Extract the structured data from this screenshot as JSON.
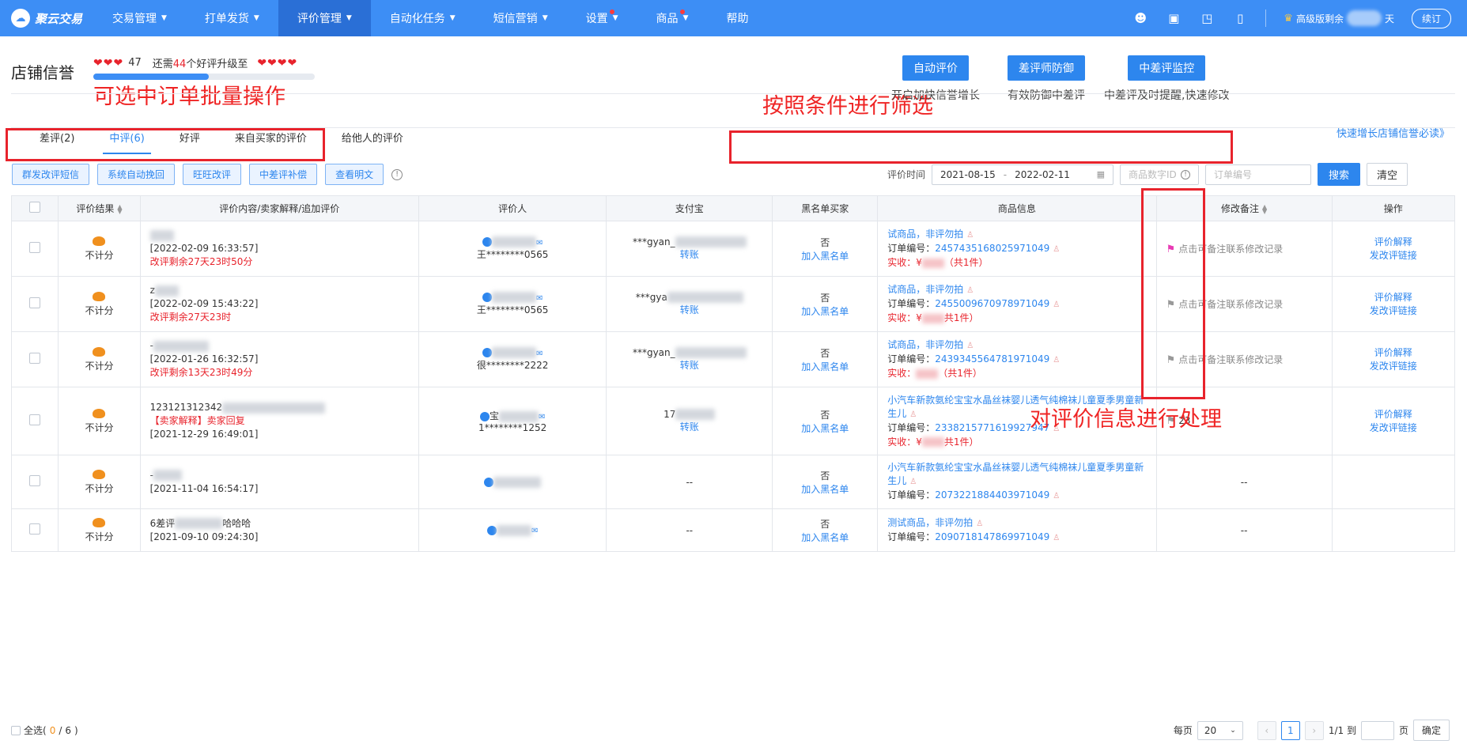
{
  "topbar": {
    "logo_text": "聚云交易",
    "nav": [
      {
        "label": "交易管理",
        "caret": true,
        "dot": false,
        "active": false
      },
      {
        "label": "打单发货",
        "caret": true,
        "dot": false,
        "active": false
      },
      {
        "label": "评价管理",
        "caret": true,
        "dot": false,
        "active": true
      },
      {
        "label": "自动化任务",
        "caret": true,
        "dot": false,
        "active": false
      },
      {
        "label": "短信营销",
        "caret": true,
        "dot": false,
        "active": false
      },
      {
        "label": "设置",
        "caret": true,
        "dot": true,
        "active": false
      },
      {
        "label": "商品",
        "caret": true,
        "dot": true,
        "active": false
      },
      {
        "label": "帮助",
        "caret": false,
        "dot": false,
        "active": false
      }
    ],
    "version_label": "高级版剩余",
    "version_suffix": "天",
    "renew_label": "续订"
  },
  "credit": {
    "title": "店铺信誉",
    "current_hearts": "❤❤❤",
    "score": "47",
    "need_prefix": "还需",
    "need_count": "44",
    "need_suffix": "个好评升级至",
    "next_hearts": "❤❤❤❤",
    "progress": 0.52
  },
  "promos": [
    {
      "button": "自动评价",
      "desc": "开启加快信誉增长"
    },
    {
      "button": "差评师防御",
      "desc": "有效防御中差评"
    },
    {
      "button": "中差评监控",
      "desc": "中差评及时提醒,快速修改"
    }
  ],
  "annotations": {
    "batch": "可选中订单批量操作",
    "filter": "按照条件进行筛选",
    "process": "对评价信息进行处理"
  },
  "tabs": [
    "差评(2)",
    "中评(6)",
    "好评",
    "来自买家的评价",
    "给他人的评价"
  ],
  "quick_link": "快速增长店铺信誉必读》",
  "action_buttons": [
    "群发改评短信",
    "系统自动挽回",
    "旺旺改评",
    "中差评补偿",
    "查看明文"
  ],
  "filters": {
    "label": "评价时间",
    "date_from": "2021-08-15",
    "date_sep": "-",
    "date_to": "2022-02-11",
    "product_id_placeholder": "商品数字ID",
    "order_no_placeholder": "订单编号",
    "search_label": "搜索",
    "clear_label": "清空"
  },
  "table": {
    "headers": [
      "评价结果",
      "评价内容/卖家解释/追加评价",
      "评价人",
      "支付宝",
      "黑名单买家",
      "商品信息",
      "修改备注",
      "操作"
    ],
    "rows": [
      {
        "result": "不计分",
        "content_head": "",
        "time": "[2022-02-09 16:33:57]",
        "extra": "改评剩余27天23时50分",
        "reviewer_id": "王********0565",
        "alipay": "***gyan_",
        "alipay_action": "转账",
        "blacklist": "否",
        "blacklist_action": "加入黑名单",
        "goods_title": "试商品，非评勿拍",
        "order_label": "订单编号：",
        "order_no": "2457435168025971049",
        "paid_label": "实收：¥",
        "paid_count": "（共1件）",
        "remark": "点击可备注联系修改记录",
        "remark_flag": "pink",
        "op1": "评价解释",
        "op2": "发改评链接"
      },
      {
        "result": "不计分",
        "content_head": "z",
        "time": "[2022-02-09 15:43:22]",
        "extra": "改评剩余27天23时",
        "reviewer_id": "王********0565",
        "alipay": "***gya",
        "alipay_action": "转账",
        "blacklist": "否",
        "blacklist_action": "加入黑名单",
        "goods_title": "试商品，非评勿拍",
        "order_label": "订单编号：",
        "order_no": "2455009670978971049",
        "paid_label": "实收：¥",
        "paid_count": "共1件）",
        "remark": "点击可备注联系修改记录",
        "remark_flag": "gray",
        "op1": "评价解释",
        "op2": "发改评链接"
      },
      {
        "result": "不计分",
        "content_head": "-",
        "time": "[2022-01-26 16:32:57]",
        "extra": "改评剩余13天23时49分",
        "reviewer_id": "很********2222",
        "alipay": "***gyan_",
        "alipay_action": "转账",
        "blacklist": "否",
        "blacklist_action": "加入黑名单",
        "goods_title": "试商品，非评勿拍",
        "order_label": "订单编号：",
        "order_no": "2439345564781971049",
        "paid_label": "实收：",
        "paid_count": "（共1件）",
        "remark": "点击可备注联系修改记录",
        "remark_flag": "gray",
        "op1": "评价解释",
        "op2": "发改评链接"
      },
      {
        "result": "不计分",
        "content_head": "123121312342",
        "time": "[2021-12-29 16:49:01]",
        "seller_reply": "【卖家解释】卖家回复",
        "reviewer_name": "宝",
        "reviewer_id": "1********1252",
        "alipay": "17",
        "alipay_action": "转账",
        "blacklist": "否",
        "blacklist_action": "加入黑名单",
        "goods_title": "小汽车新款氨纶宝宝水晶丝袜婴儿透气纯棉袜儿童夏季男童新生儿",
        "order_label": "订单编号：",
        "order_no": "2338215771619927947",
        "paid_label": "实收：¥",
        "paid_count": "共1件）",
        "remark": "23",
        "remark_flag": "gray",
        "op1": "评价解释",
        "op2": "发改评链接"
      },
      {
        "result": "不计分",
        "content_head": "-",
        "time": "[2021-11-04 16:54:17]",
        "reviewer_id": "",
        "alipay": "--",
        "blacklist": "否",
        "blacklist_action": "加入黑名单",
        "goods_title": "小汽车新款氨纶宝宝水晶丝袜婴儿透气纯棉袜儿童夏季男童新生儿",
        "order_label": "订单编号：",
        "order_no": "2073221884403971049",
        "remark": "--"
      },
      {
        "result": "不计分",
        "content_head": "6差评",
        "content_tail": "哈哈哈",
        "time": "[2021-09-10 09:24:30]",
        "reviewer_id": "",
        "alipay": "--",
        "blacklist": "否",
        "blacklist_action": "加入黑名单",
        "goods_title": "测试商品，非评勿拍",
        "order_label": "订单编号：",
        "order_no": "2090718147869971049",
        "remark": "--"
      }
    ]
  },
  "footer": {
    "select_all": "全选(",
    "selected": "0",
    "total": "6",
    "select_all_close": ")",
    "per_page_label": "每页",
    "per_page": "20",
    "current_page": "1",
    "page_info": "1/1 到",
    "page_unit": "页",
    "confirm": "确定"
  }
}
